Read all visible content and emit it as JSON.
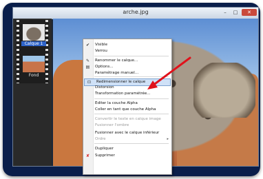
{
  "window": {
    "title": "arche.jpg",
    "minimize_glyph": "–",
    "maximize_glyph": "□",
    "close_glyph": "✕"
  },
  "layers": [
    {
      "label": "Calque 1",
      "selected": true
    },
    {
      "label": "Fond",
      "selected": false
    }
  ],
  "menu": {
    "items": [
      {
        "label": "Visible",
        "icon": "checkmark-icon",
        "glyph": "✔",
        "disabled": false
      },
      {
        "label": "Verrou",
        "icon": "",
        "glyph": "",
        "disabled": false
      },
      {
        "label": "Renommer le calque...",
        "icon": "rename-icon",
        "glyph": "✎",
        "disabled": false
      },
      {
        "label": "Options...",
        "icon": "options-icon",
        "glyph": "▤",
        "disabled": false
      },
      {
        "label": "Paramétrage manuel...",
        "icon": "",
        "glyph": "",
        "disabled": false
      },
      {
        "label": "Redimensionner le calque",
        "icon": "resize-icon",
        "glyph": "⊡",
        "disabled": false,
        "highlighted": true
      },
      {
        "label": "Distorsion",
        "icon": "",
        "glyph": "",
        "disabled": false
      },
      {
        "label": "Transformation paramétrée...",
        "icon": "",
        "glyph": "",
        "disabled": false
      },
      {
        "label": "Editer la couche Alpha",
        "icon": "",
        "glyph": "",
        "disabled": false
      },
      {
        "label": "Coller en tant que couche Alpha",
        "icon": "",
        "glyph": "",
        "disabled": false
      },
      {
        "label": "Convertir le texte en calque image",
        "icon": "",
        "glyph": "",
        "disabled": true
      },
      {
        "label": "Fusionner l'ombre",
        "icon": "",
        "glyph": "",
        "disabled": true
      },
      {
        "label": "Fusionner avec le calque inférieur",
        "icon": "",
        "glyph": "",
        "disabled": false
      },
      {
        "label": "Ordre",
        "icon": "",
        "glyph": "",
        "disabled": true,
        "submenu": true
      },
      {
        "label": "Dupliquer",
        "icon": "",
        "glyph": "",
        "disabled": false
      },
      {
        "label": "Supprimer",
        "icon": "delete-icon",
        "glyph": "✘",
        "disabled": false
      }
    ],
    "submenu_glyph": "▸"
  },
  "colors": {
    "frame": "#0a1e4a",
    "highlight": "#cfe1f7",
    "arrow": "#e0121b",
    "delete_icon": "#d42020"
  }
}
